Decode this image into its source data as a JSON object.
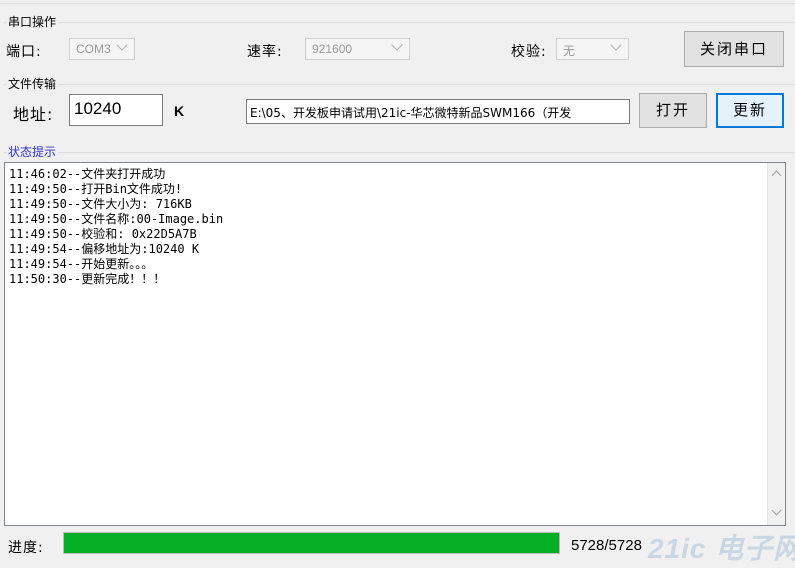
{
  "serial": {
    "group_title": "串口操作",
    "port_label": "端口:",
    "port_value": "COM3",
    "baud_label": "速率:",
    "baud_value": "921600",
    "parity_label": "校验:",
    "parity_value": "无",
    "close_button": "关闭串口"
  },
  "transfer": {
    "group_title": "文件传输",
    "address_label": "地址:",
    "address_value": "10240",
    "address_unit": "K",
    "file_path": "E:\\05、开发板申请试用\\21ic-华芯微特新品SWM166（开发",
    "open_button": "打开",
    "update_button": "更新"
  },
  "status": {
    "group_title": "状态提示",
    "lines": [
      "11:46:02--文件夹打开成功",
      "11:49:50--打开Bin文件成功!",
      "11:49:50--文件大小为: 716KB",
      "11:49:50--文件名称:00-Image.bin",
      "11:49:50--校验和: 0x22D5A7B",
      "11:49:54--偏移地址为:10240  K",
      "11:49:54--开始更新。。。",
      "11:50:30--更新完成！！！"
    ]
  },
  "progress": {
    "label": "进度:",
    "current": 5728,
    "total": 5728,
    "text": "5728/5728"
  },
  "watermark": {
    "text": "21ic 电子网"
  },
  "colors": {
    "progress_fill": "#06b025",
    "focus_border": "#0078d7",
    "group_title_status": "#3333cc"
  }
}
